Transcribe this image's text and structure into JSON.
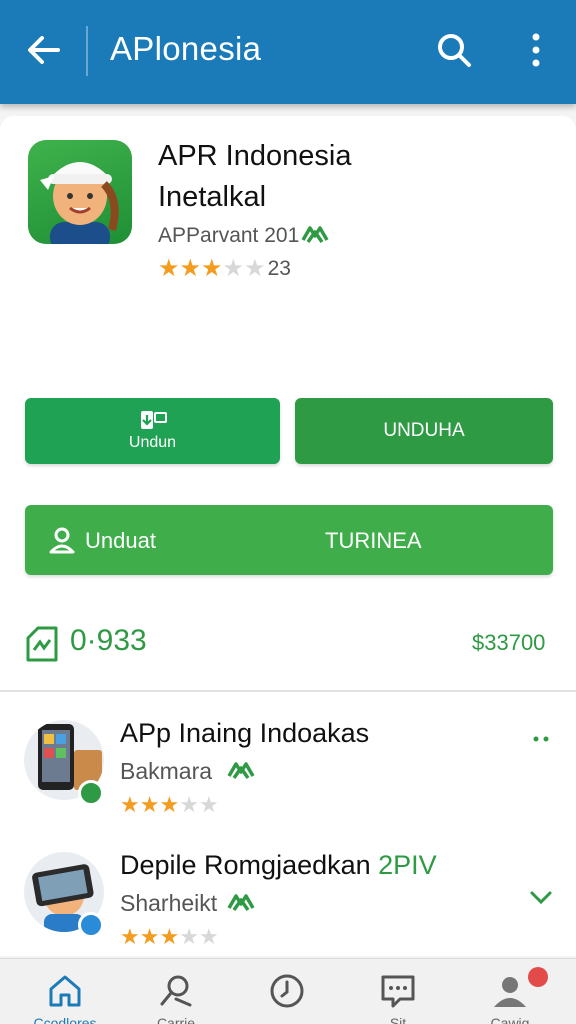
{
  "appbar": {
    "title": "APlonesia",
    "back_icon": "arrow-left-icon",
    "search_icon": "search-icon",
    "more_icon": "more-vert-icon"
  },
  "app": {
    "name": "APR Indonesia",
    "status": "Inetalkal",
    "developer": "APParvant 201",
    "rating_stars": 3,
    "rating_max": 5,
    "rating_count": "23"
  },
  "buttons": {
    "install_label": "Undun",
    "download_label": "UNDUHA",
    "wide_left_label": "Unduat",
    "wide_right_label": "TURINEA"
  },
  "stats": {
    "left": "0·933",
    "right": "$33700"
  },
  "list": [
    {
      "title": "APp Inaing Indoakas",
      "title_accent": "",
      "subtitle": "Bakmara",
      "stars": 3,
      "max": 5,
      "action_icon": "more-horiz-icon"
    },
    {
      "title": "Depile Romgjaedkan ",
      "title_accent": "2PIV",
      "subtitle": "Sharheikt",
      "stars": 3,
      "max": 5,
      "action_icon": "chevron-down-icon"
    }
  ],
  "nav": [
    {
      "label": "Ccodlores",
      "icon": "home-icon",
      "active": true
    },
    {
      "label": "Carrie",
      "icon": "search-icon",
      "active": false
    },
    {
      "label": "",
      "icon": "clock-icon",
      "active": false
    },
    {
      "label": "Sit",
      "icon": "chat-icon",
      "active": false
    },
    {
      "label": "Cawig",
      "icon": "profile-icon",
      "active": false
    }
  ],
  "colors": {
    "primary": "#1a7bb8",
    "accent_green": "#2e9a44",
    "star": "#f39c1f"
  }
}
